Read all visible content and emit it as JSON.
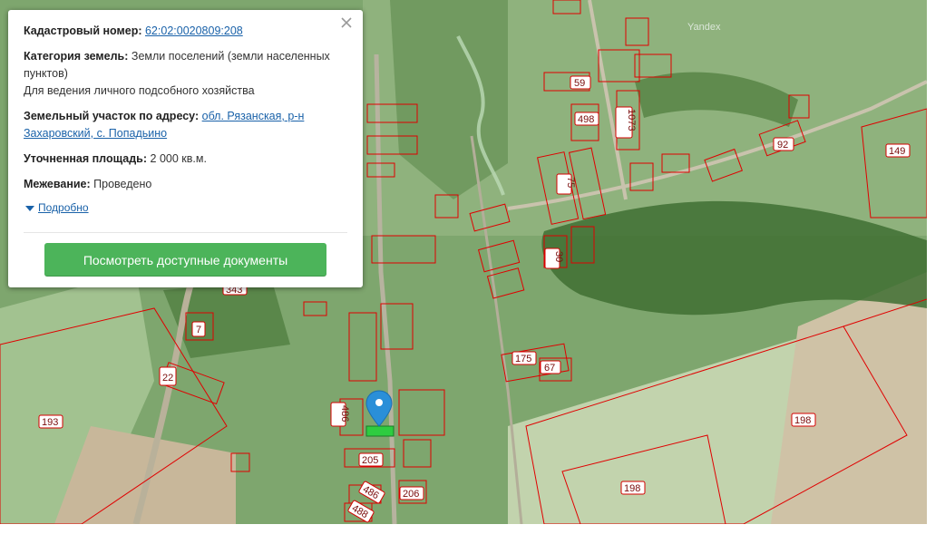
{
  "info": {
    "cadastral_label": "Кадастровый номер:",
    "cadastral_value": "62:02:0020809:208",
    "category_label": "Категория земель:",
    "category_value": "Земли поселений (земли населенных пунктов)",
    "use_value": "Для ведения личного подсобного хозяйства",
    "address_label": "Земельный участок по адресу:",
    "address_value": "обл. Рязанская, р-н Захаровский, с. Попадьино",
    "area_label": "Уточненная площадь:",
    "area_value": "2 000 кв.м.",
    "survey_label": "Межевание:",
    "survey_value": "Проведено",
    "more_label": "Подробно",
    "button_label": "Посмотреть доступные документы"
  },
  "map": {
    "watermark": "Yandex",
    "labels": [
      "59",
      "498",
      "1073",
      "92",
      "149",
      "75",
      "30",
      "7",
      "343",
      "22",
      "486",
      "175",
      "67",
      "193",
      "198",
      "198",
      "205",
      "206",
      "486",
      "488"
    ],
    "marker_color": "#2a8fd8",
    "parcel_color": "#e00000",
    "selected_parcel_color": "#2ecc40"
  }
}
